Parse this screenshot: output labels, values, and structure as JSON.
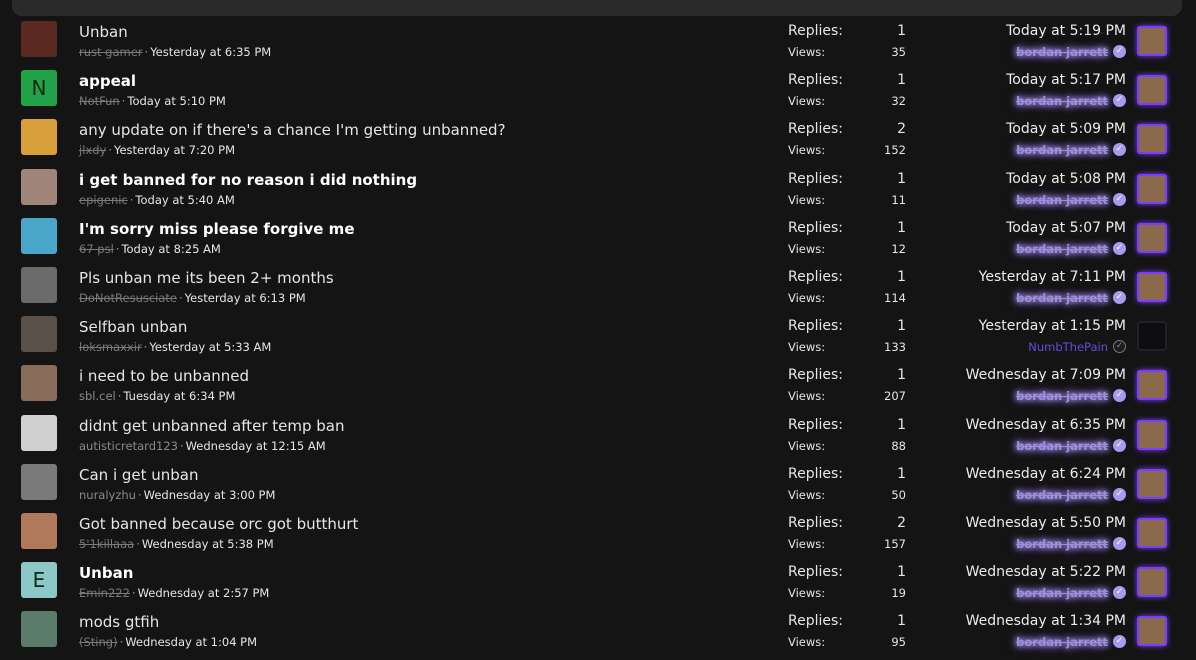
{
  "threads": [
    {
      "title": "Unban",
      "bold": false,
      "author": "rust gamer",
      "strike": true,
      "date": "Yesterday at 6:35 PM",
      "replies": "1",
      "views": "35",
      "last_date": "Today at 5:19 PM",
      "last_user": "bordan jarrett",
      "avatar_color": "#5a2a22",
      "avatar_letter": "",
      "last_plain": false
    },
    {
      "title": "appeal",
      "bold": true,
      "author": "NotFun",
      "strike": true,
      "date": "Today at 5:10 PM",
      "replies": "1",
      "views": "32",
      "last_date": "Today at 5:17 PM",
      "last_user": "bordan jarrett",
      "avatar_color": "#22a34a",
      "avatar_letter": "N",
      "last_plain": false
    },
    {
      "title": "any update on if there's a chance I'm getting unbanned?",
      "bold": false,
      "author": "jlxdy",
      "strike": true,
      "date": "Yesterday at 7:20 PM",
      "replies": "2",
      "views": "152",
      "last_date": "Today at 5:09 PM",
      "last_user": "bordan jarrett",
      "avatar_color": "#d8a03a",
      "avatar_letter": "",
      "last_plain": false
    },
    {
      "title": "i get banned for no reason i did nothing",
      "bold": true,
      "author": "epigenic",
      "strike": true,
      "date": "Today at 5:40 AM",
      "replies": "1",
      "views": "11",
      "last_date": "Today at 5:08 PM",
      "last_user": "bordan jarrett",
      "avatar_color": "#a0857a",
      "avatar_letter": "",
      "last_plain": false
    },
    {
      "title": "I'm sorry miss please forgive me",
      "bold": true,
      "author": "67 psl",
      "strike": true,
      "date": "Today at 8:25 AM",
      "replies": "1",
      "views": "12",
      "last_date": "Today at 5:07 PM",
      "last_user": "bordan jarrett",
      "avatar_color": "#4aa6c8",
      "avatar_letter": "",
      "last_plain": false
    },
    {
      "title": "Pls unban me its been 2+ months",
      "bold": false,
      "author": "DoNotResusciate",
      "strike": true,
      "date": "Yesterday at 6:13 PM",
      "replies": "1",
      "views": "114",
      "last_date": "Yesterday at 7:11 PM",
      "last_user": "bordan jarrett",
      "avatar_color": "#6b6b6b",
      "avatar_letter": "",
      "last_plain": false
    },
    {
      "title": "Selfban unban",
      "bold": false,
      "author": "loksmaxxir",
      "strike": true,
      "date": "Yesterday at 5:33 AM",
      "replies": "1",
      "views": "133",
      "last_date": "Yesterday at 1:15 PM",
      "last_user": "NumbThePain",
      "avatar_color": "#5a5048",
      "avatar_letter": "",
      "last_plain": true
    },
    {
      "title": "i need to be unbanned",
      "bold": false,
      "author": "sbl.cel",
      "strike": false,
      "date": "Tuesday at 6:34 PM",
      "replies": "1",
      "views": "207",
      "last_date": "Wednesday at 7:09 PM",
      "last_user": "bordan jarrett",
      "avatar_color": "#8a6c5a",
      "avatar_letter": "",
      "last_plain": false
    },
    {
      "title": "didnt get unbanned after temp ban",
      "bold": false,
      "author": "autisticretard123",
      "strike": false,
      "date": "Wednesday at 12:15 AM",
      "replies": "1",
      "views": "88",
      "last_date": "Wednesday at 6:35 PM",
      "last_user": "bordan jarrett",
      "avatar_color": "#d0d0d0",
      "avatar_letter": "",
      "last_plain": false
    },
    {
      "title": "Can i get unban",
      "bold": false,
      "author": "nuralyzhu",
      "strike": false,
      "date": "Wednesday at 3:00 PM",
      "replies": "1",
      "views": "50",
      "last_date": "Wednesday at 6:24 PM",
      "last_user": "bordan jarrett",
      "avatar_color": "#7a7a7a",
      "avatar_letter": "",
      "last_plain": false
    },
    {
      "title": "Got banned because orc got butthurt",
      "bold": false,
      "author": "5'1killaaa",
      "strike": true,
      "date": "Wednesday at 5:38 PM",
      "replies": "2",
      "views": "157",
      "last_date": "Wednesday at 5:50 PM",
      "last_user": "bordan jarrett",
      "avatar_color": "#b07a5a",
      "avatar_letter": "",
      "last_plain": false
    },
    {
      "title": "Unban",
      "bold": true,
      "author": "Emin222",
      "strike": true,
      "date": "Wednesday at 2:57 PM",
      "replies": "1",
      "views": "19",
      "last_date": "Wednesday at 5:22 PM",
      "last_user": "bordan jarrett",
      "avatar_color": "#8cc8c8",
      "avatar_letter": "E",
      "last_plain": false
    },
    {
      "title": "mods gtfih",
      "bold": false,
      "author": "(Sting)",
      "strike": true,
      "date": "Wednesday at 1:04 PM",
      "replies": "1",
      "views": "95",
      "last_date": "Wednesday at 1:34 PM",
      "last_user": "bordan jarrett",
      "avatar_color": "#5a7a6a",
      "avatar_letter": "",
      "last_plain": false
    }
  ],
  "labels": {
    "replies": "Replies:",
    "views": "Views:",
    "sep": "·"
  },
  "icons": {
    "verify": "verified-check-icon"
  }
}
